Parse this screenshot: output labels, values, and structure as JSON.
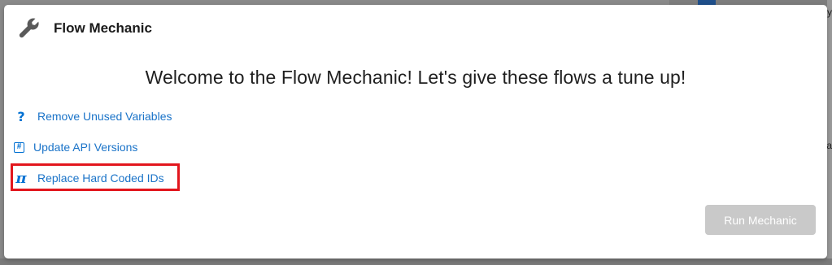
{
  "background": {
    "right_char_1": "y",
    "right_char_2": "a"
  },
  "modal": {
    "title": "Flow Mechanic",
    "header_icon": "wrench-icon",
    "welcome_text": "Welcome to the Flow Mechanic! Let's give these flows a tune up!",
    "options": [
      {
        "label": "Remove Unused Variables",
        "icon": "question-icon",
        "icon_glyph": "?"
      },
      {
        "label": "Update API Versions",
        "icon": "hash-icon",
        "icon_glyph": "#"
      },
      {
        "label": "Replace Hard Coded IDs",
        "icon": "pi-icon",
        "icon_glyph": "π",
        "highlighted": true
      }
    ],
    "run_button_label": "Run Mechanic",
    "run_button_disabled": true
  },
  "colors": {
    "link": "#1a73c8",
    "icon_blue": "#0070d2",
    "highlight": "#e2161d",
    "disabled_button": "#c9c9c9"
  }
}
